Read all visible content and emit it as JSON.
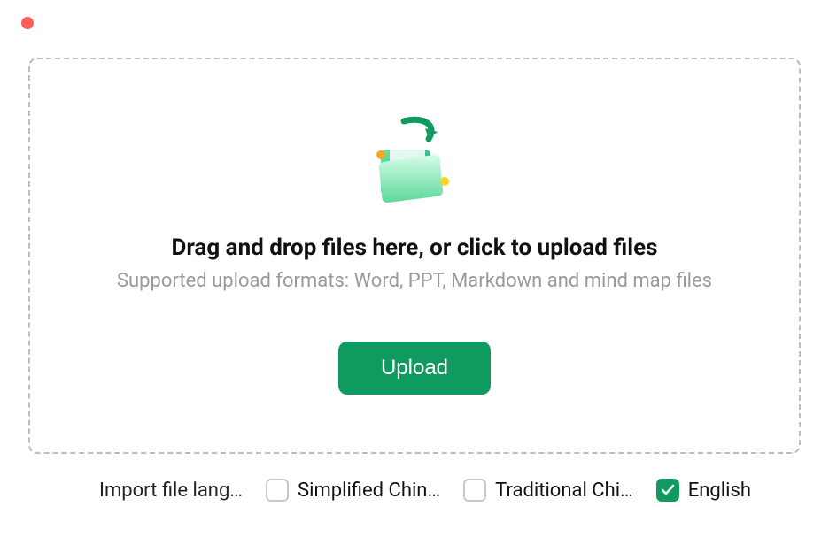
{
  "window": {
    "close_color": "#ff5f57"
  },
  "dropzone": {
    "title": "Drag and drop files here, or click to upload files",
    "subtitle": "Supported upload formats: Word, PPT, Markdown and mind map files",
    "upload_label": "Upload"
  },
  "language": {
    "label": "Import file lang…",
    "options": [
      {
        "label": "Simplified Chin…",
        "checked": false
      },
      {
        "label": "Traditional Chi…",
        "checked": false
      },
      {
        "label": "English",
        "checked": true
      }
    ]
  },
  "colors": {
    "accent": "#0f9a5f",
    "muted": "#9a9a9a",
    "border": "#bdbdbd"
  }
}
